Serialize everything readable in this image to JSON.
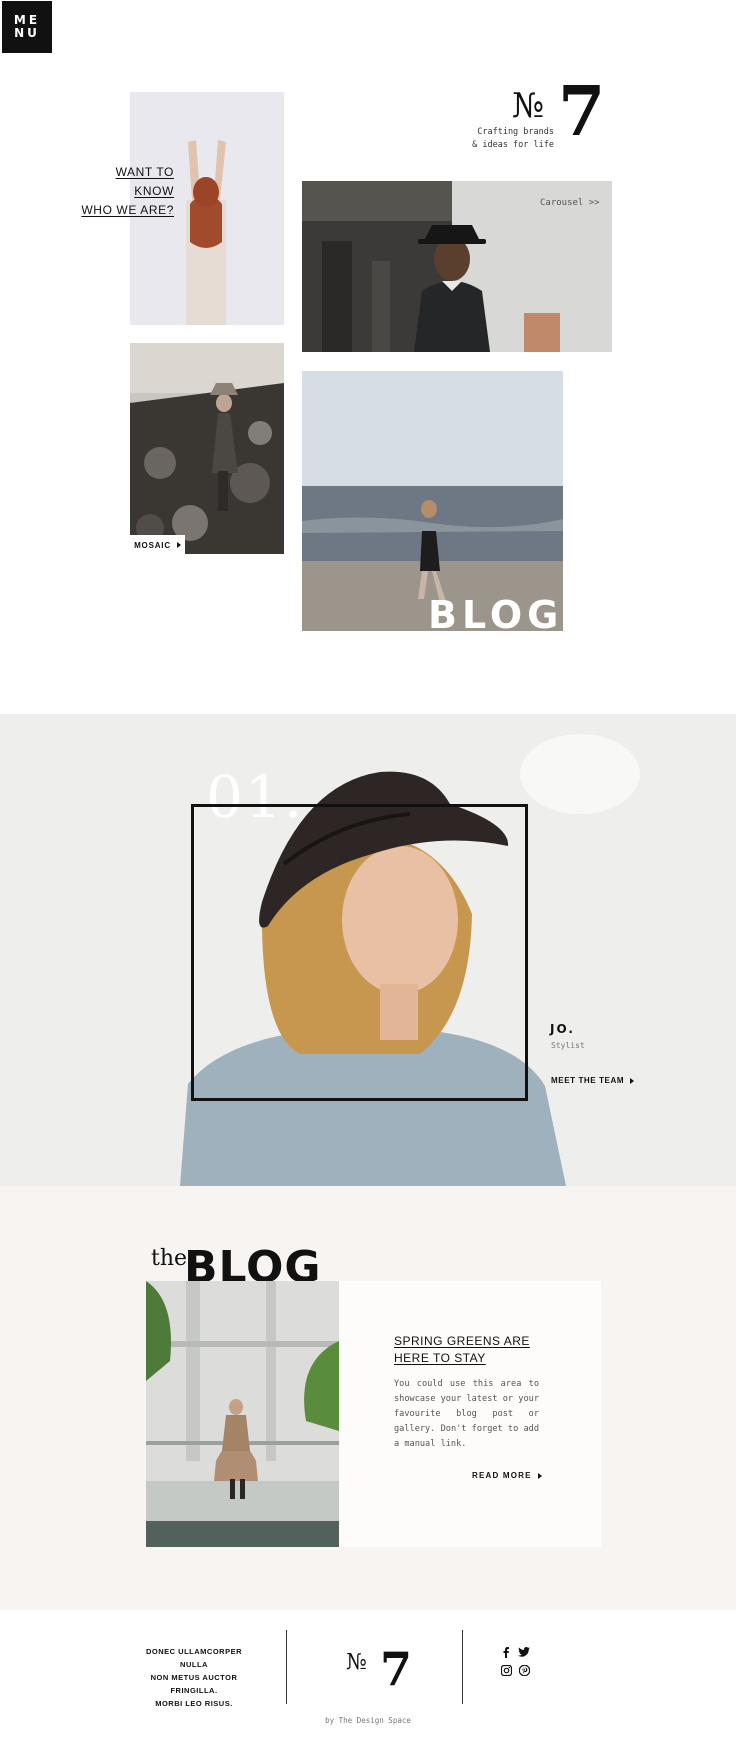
{
  "menu": {
    "line1": "ME",
    "line2": "NU"
  },
  "logo": {
    "numero": "№",
    "number": "7",
    "tagline_line1": "Crafting brands",
    "tagline_line2": "& ideas for life"
  },
  "about_link": {
    "line1": "WANT TO KNOW",
    "line2": "WHO WE ARE?"
  },
  "carousel_link": "Carousel >>",
  "mosaic_label": "MOSAIC",
  "blog_overlay": "BLOG",
  "team": {
    "number": "01.",
    "name": "JO.",
    "role": "Stylist",
    "cta": "MEET THE TEAM"
  },
  "blog": {
    "heading_small": "the",
    "heading_large": "BLOG",
    "post_title_line1": "SPRING GREENS ARE",
    "post_title_line2": "HERE TO STAY",
    "post_body": "You could use this area to showcase your latest or your favourite blog post or gallery. Don't forget to add a manual link.",
    "cta": "READ MORE"
  },
  "footer": {
    "text_line1": "DONEC ULLAMCORPER NULLA",
    "text_line2": "NON METUS AUCTOR FRINGILLA.",
    "text_line3": "MORBI LEO RISUS.",
    "logo_numero": "№",
    "logo_number": "7",
    "credit": "by The Design Space",
    "social_icons": [
      "facebook-icon",
      "twitter-icon",
      "instagram-icon",
      "pinterest-icon"
    ]
  }
}
